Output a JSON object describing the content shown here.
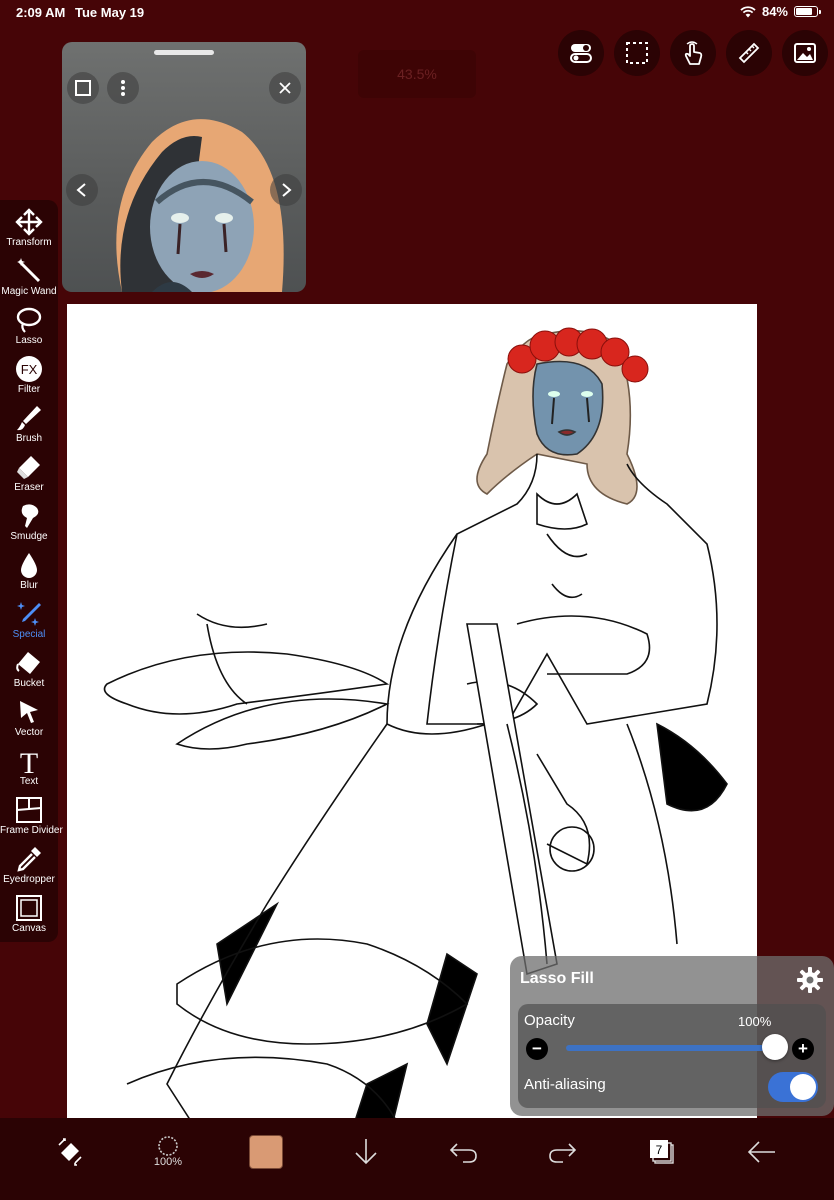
{
  "status_bar": {
    "time": "2:09 AM",
    "date": "Tue May 19",
    "battery": "84%",
    "battery_level": 0.84
  },
  "zoom_readout": "43.5%",
  "top_buttons": [
    {
      "name": "toggle-panel-button",
      "icon": "switch-icon"
    },
    {
      "name": "selection-button",
      "icon": "dashed-rect-icon"
    },
    {
      "name": "gesture-button",
      "icon": "hand-icon"
    },
    {
      "name": "ruler-button",
      "icon": "ruler-icon"
    },
    {
      "name": "gallery-button",
      "icon": "image-icon"
    }
  ],
  "tools": [
    {
      "label": "Transform",
      "icon": "move-arrows-icon"
    },
    {
      "label": "Magic Wand",
      "icon": "magic-wand-icon"
    },
    {
      "label": "Lasso",
      "icon": "lasso-icon"
    },
    {
      "label": "Filter",
      "icon": "fx-icon",
      "glyph": "FX"
    },
    {
      "label": "Brush",
      "icon": "brush-icon"
    },
    {
      "label": "Eraser",
      "icon": "eraser-icon"
    },
    {
      "label": "Smudge",
      "icon": "smudge-icon"
    },
    {
      "label": "Blur",
      "icon": "drop-icon"
    },
    {
      "label": "Special",
      "icon": "sparkle-pen-icon",
      "active": true
    },
    {
      "label": "Bucket",
      "icon": "bucket-icon"
    },
    {
      "label": "Vector",
      "icon": "cursor-icon"
    },
    {
      "label": "Text",
      "icon": "text-icon",
      "glyph": "T"
    },
    {
      "label": "Frame Divider",
      "icon": "frame-divider-icon"
    },
    {
      "label": "Eyedropper",
      "icon": "eyedropper-icon"
    },
    {
      "label": "Canvas",
      "icon": "canvas-icon"
    }
  ],
  "lasso_fill": {
    "title": "Lasso Fill",
    "opacity_label": "Opacity",
    "opacity_value": "100%",
    "opacity_level": 1.0,
    "minus": "−",
    "plus": "+",
    "anti_aliasing_label": "Anti-aliasing",
    "anti_aliasing_on": true
  },
  "bottom_bar": {
    "brush_size": "100%",
    "current_color": "#d99a74",
    "layer_count": "7"
  },
  "colors": {
    "background": "#460507",
    "toolbar": "#2b0304",
    "accent": "#4d8ff7"
  }
}
